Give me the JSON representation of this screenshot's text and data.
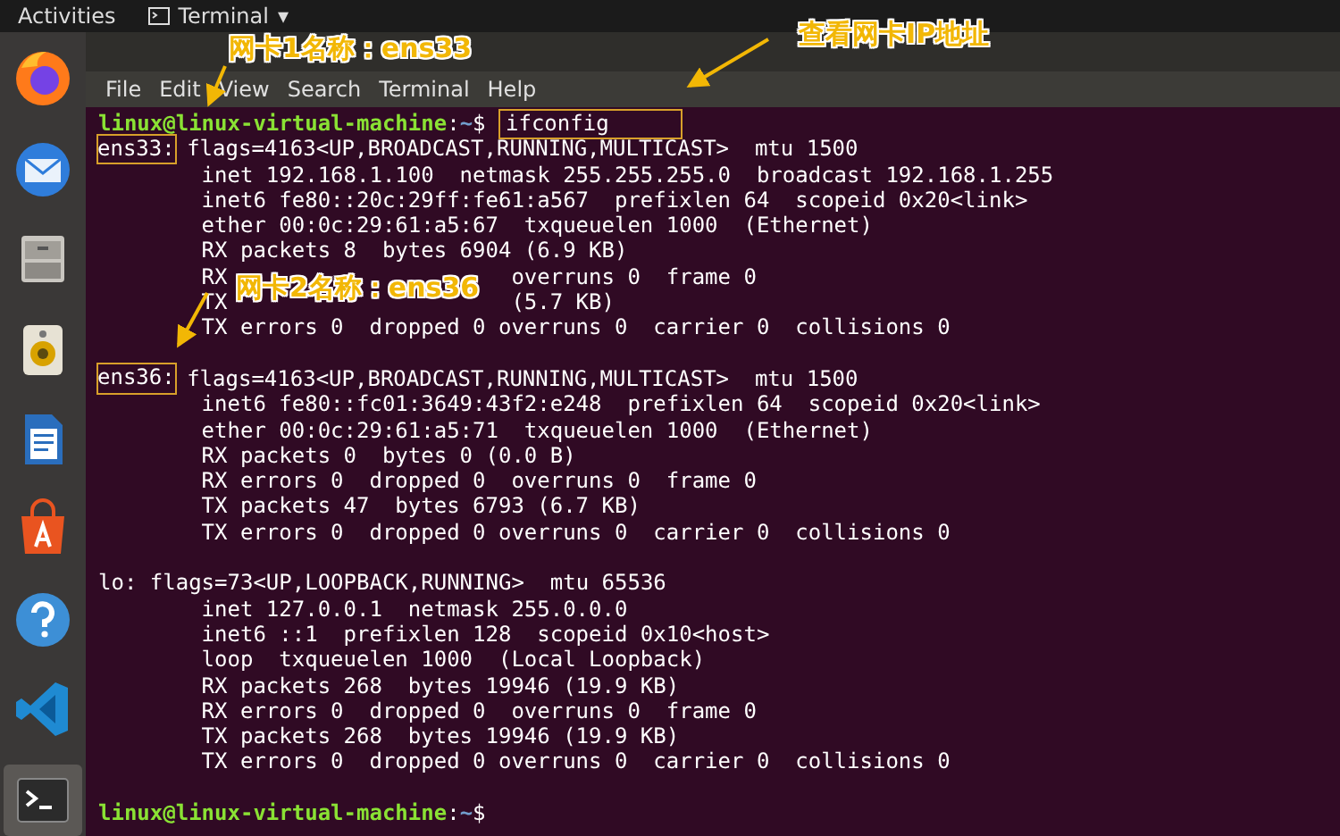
{
  "top_bar": {
    "activities": "Activities",
    "app_menu": "Terminal",
    "app_menu_caret": "▾"
  },
  "dock": {
    "items": [
      {
        "kind": "firefox",
        "selected": false
      },
      {
        "kind": "mail",
        "selected": false
      },
      {
        "kind": "files",
        "selected": false
      },
      {
        "kind": "speaker",
        "selected": false
      },
      {
        "kind": "writer",
        "selected": false
      },
      {
        "kind": "software",
        "selected": false
      },
      {
        "kind": "help",
        "selected": false
      },
      {
        "kind": "code",
        "selected": false
      },
      {
        "kind": "terminal",
        "selected": true
      }
    ]
  },
  "terminal": {
    "menu": [
      "File",
      "Edit",
      "View",
      "Search",
      "Terminal",
      "Help"
    ],
    "lines": [
      {
        "kind": "prompt",
        "user_host": "linux@linux-virtual-machine",
        "separator": ":",
        "path": "~",
        "symbol": "$",
        "command": "ifconfig",
        "boxed": true
      },
      {
        "kind": "iface",
        "name": "ens33:",
        "boxed": true,
        "text": "flags=4163<UP,BROADCAST,RUNNING,MULTICAST>  mtu 1500"
      },
      {
        "kind": "detail",
        "text": "inet 192.168.1.100  netmask 255.255.255.0  broadcast 192.168.1.255"
      },
      {
        "kind": "detail",
        "text": "inet6 fe80::20c:29ff:fe61:a567  prefixlen 64  scopeid 0x20<link>"
      },
      {
        "kind": "detail",
        "text": "ether 00:0c:29:61:a5:67  txqueuelen 1000  (Ethernet)"
      },
      {
        "kind": "detail",
        "text": "RX packets 8  bytes 6904 (6.9 KB)"
      },
      {
        "kind": "covered",
        "before": "RX",
        "after": "overruns 0  frame 0"
      },
      {
        "kind": "covered",
        "before": "TX",
        "after": "(5.7 KB)"
      },
      {
        "kind": "detail",
        "text": "TX errors 0  dropped 0 overruns 0  carrier 0  collisions 0"
      },
      {
        "kind": "blank"
      },
      {
        "kind": "iface",
        "name": "ens36:",
        "boxed": true,
        "text": "flags=4163<UP,BROADCAST,RUNNING,MULTICAST>  mtu 1500"
      },
      {
        "kind": "detail",
        "text": "inet6 fe80::fc01:3649:43f2:e248  prefixlen 64  scopeid 0x20<link>"
      },
      {
        "kind": "detail",
        "text": "ether 00:0c:29:61:a5:71  txqueuelen 1000  (Ethernet)"
      },
      {
        "kind": "detail",
        "text": "RX packets 0  bytes 0 (0.0 B)"
      },
      {
        "kind": "detail",
        "text": "RX errors 0  dropped 0  overruns 0  frame 0"
      },
      {
        "kind": "detail",
        "text": "TX packets 47  bytes 6793 (6.7 KB)"
      },
      {
        "kind": "detail",
        "text": "TX errors 0  dropped 0 overruns 0  carrier 0  collisions 0"
      },
      {
        "kind": "blank"
      },
      {
        "kind": "iface",
        "name": "lo:",
        "text": "flags=73<UP,LOOPBACK,RUNNING>  mtu 65536"
      },
      {
        "kind": "detail",
        "text": "inet 127.0.0.1  netmask 255.0.0.0"
      },
      {
        "kind": "detail",
        "text": "inet6 ::1  prefixlen 128  scopeid 0x10<host>"
      },
      {
        "kind": "detail",
        "text": "loop  txqueuelen 1000  (Local Loopback)"
      },
      {
        "kind": "detail",
        "text": "RX packets 268  bytes 19946 (19.9 KB)"
      },
      {
        "kind": "detail",
        "text": "RX errors 0  dropped 0  overruns 0  frame 0"
      },
      {
        "kind": "detail",
        "text": "TX packets 268  bytes 19946 (19.9 KB)"
      },
      {
        "kind": "detail",
        "text": "TX errors 0  dropped 0 overruns 0  carrier 0  collisions 0"
      },
      {
        "kind": "blank"
      },
      {
        "kind": "prompt",
        "user_host": "linux@linux-virtual-machine",
        "separator": ":",
        "path": "~",
        "symbol": "$"
      }
    ]
  },
  "annotations": [
    {
      "text": "网卡1名称：ens33"
    },
    {
      "text": "查看网卡IP地址"
    },
    {
      "text": "网卡2名称：ens36"
    }
  ]
}
